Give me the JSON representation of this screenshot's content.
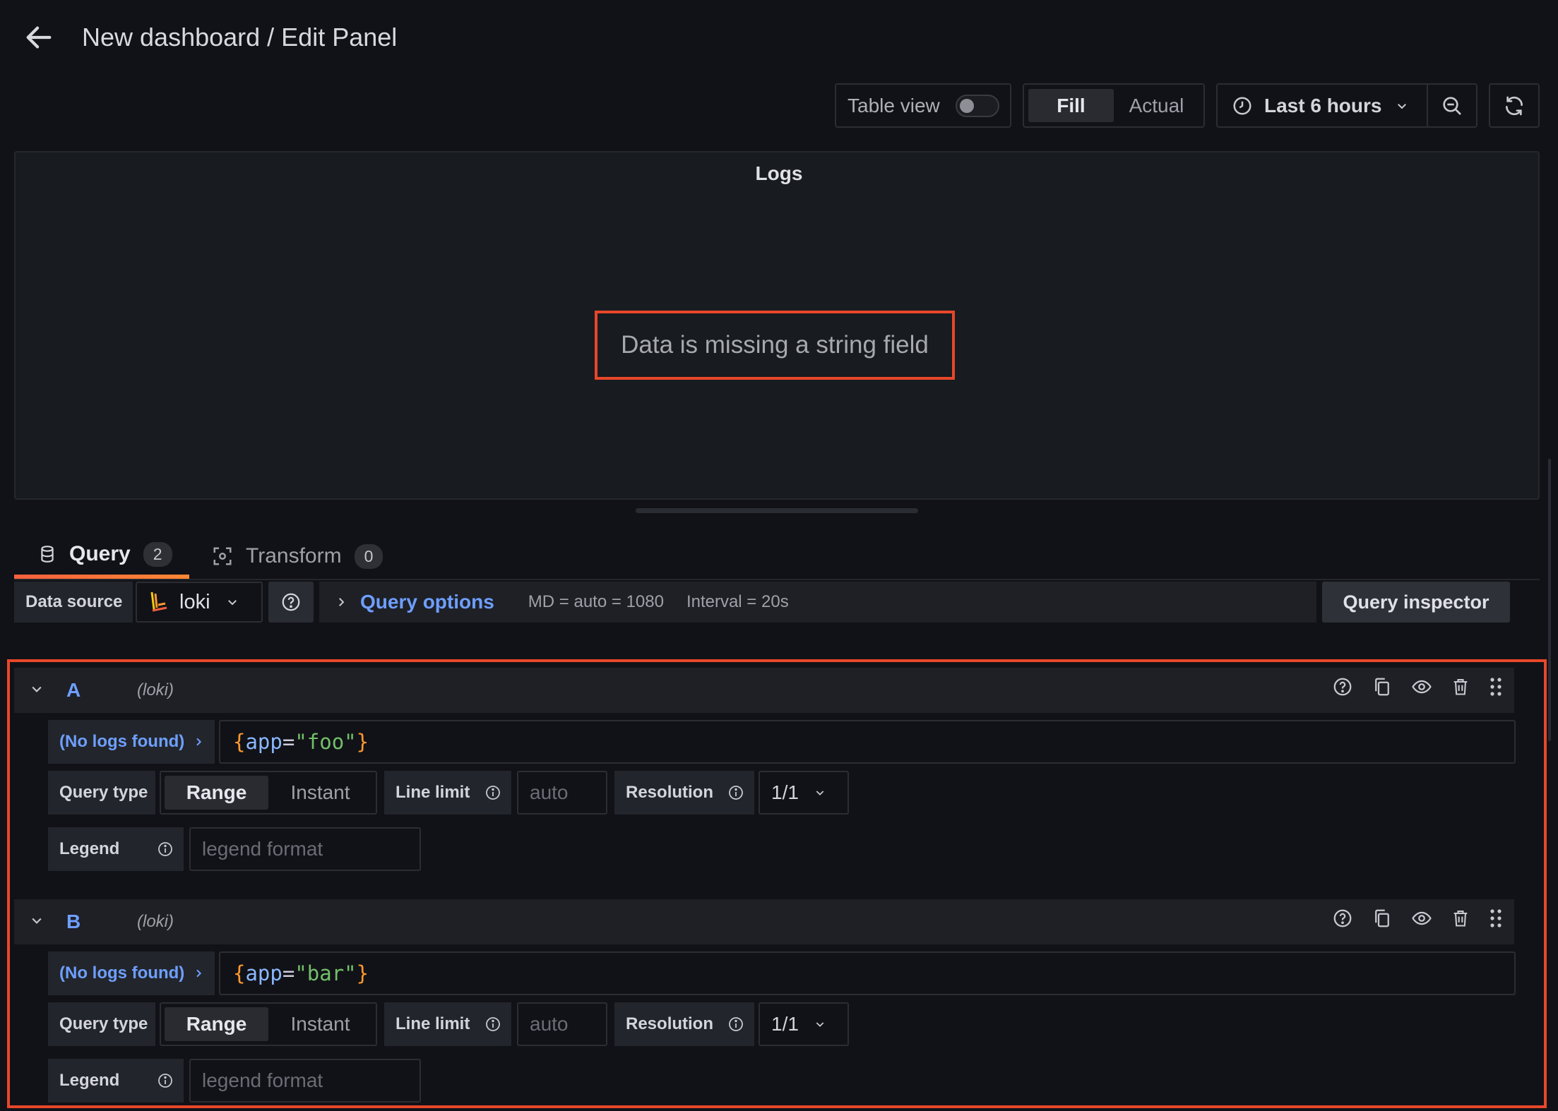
{
  "header": {
    "title": "New dashboard / Edit Panel"
  },
  "toolbar": {
    "table_view_label": "Table view",
    "table_view_on": false,
    "fill_label": "Fill",
    "actual_label": "Actual",
    "time_range": "Last 6 hours"
  },
  "panel": {
    "title": "Logs",
    "error_message": "Data is missing a string field"
  },
  "tabs": [
    {
      "label": "Query",
      "count": "2",
      "active": true
    },
    {
      "label": "Transform",
      "count": "0",
      "active": false
    }
  ],
  "datasource": {
    "label": "Data source",
    "name": "loki",
    "query_options_label": "Query options",
    "md_info": "MD = auto = 1080",
    "interval_info": "Interval = 20s",
    "query_inspector_label": "Query inspector"
  },
  "queries": [
    {
      "letter": "A",
      "datasource": "(loki)",
      "status": "(No logs found)",
      "expr": {
        "open": "{",
        "key": "app",
        "op": "=",
        "value": "\"foo\"",
        "close": "}"
      },
      "query_type_label": "Query type",
      "range_label": "Range",
      "instant_label": "Instant",
      "query_type": "Range",
      "line_limit_label": "Line limit",
      "line_limit_placeholder": "auto",
      "resolution_label": "Resolution",
      "resolution_value": "1/1",
      "legend_label": "Legend",
      "legend_placeholder": "legend format"
    },
    {
      "letter": "B",
      "datasource": "(loki)",
      "status": "(No logs found)",
      "expr": {
        "open": "{",
        "key": "app",
        "op": "=",
        "value": "\"bar\"",
        "close": "}"
      },
      "query_type_label": "Query type",
      "range_label": "Range",
      "instant_label": "Instant",
      "query_type": "Range",
      "line_limit_label": "Line limit",
      "line_limit_placeholder": "auto",
      "resolution_label": "Resolution",
      "resolution_value": "1/1",
      "legend_label": "Legend",
      "legend_placeholder": "legend format"
    }
  ],
  "colors": {
    "accent_blue": "#6e9fff",
    "highlight_red": "#e8472a",
    "tab_underline": "#f55f3e",
    "string_green": "#73bf69",
    "brace_orange": "#ff9830"
  },
  "icons": [
    "arrow-left-icon",
    "clock-icon",
    "chevron-down-icon",
    "zoom-out-icon",
    "refresh-icon",
    "database-icon",
    "transform-icon",
    "loki-logo-icon",
    "question-circle-icon",
    "chevron-right-icon",
    "copy-icon",
    "eye-icon",
    "trash-icon",
    "drag-handle-icon",
    "info-icon"
  ]
}
